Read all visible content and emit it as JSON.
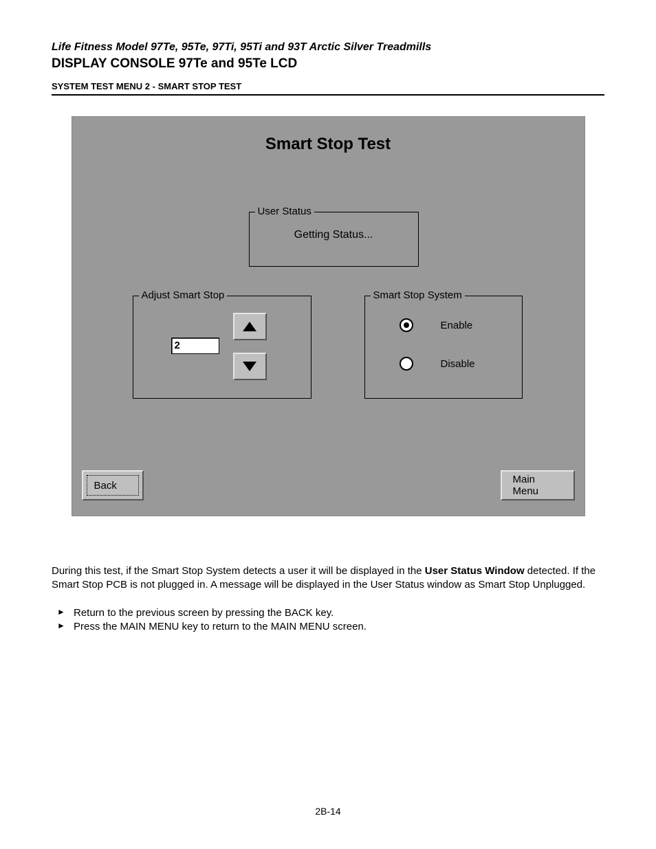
{
  "doc": {
    "supertitle": "Life Fitness Model 97Te, 95Te, 97Ti, 95Ti and 93T Arctic Silver Treadmills",
    "title": "DISPLAY CONSOLE 97Te and 95Te LCD",
    "section": "SYSTEM TEST MENU 2 - SMART STOP TEST",
    "page_number": "2B-14"
  },
  "screen": {
    "title": "Smart Stop Test",
    "user_status": {
      "legend": "User Status",
      "value": "Getting Status..."
    },
    "adjust": {
      "legend": "Adjust Smart Stop",
      "value": "2"
    },
    "system": {
      "legend": "Smart Stop System",
      "option_enable": "Enable",
      "option_disable": "Disable",
      "selected": "enable"
    },
    "buttons": {
      "back": "Back",
      "main_menu": "Main Menu"
    }
  },
  "body": {
    "paragraph_pre": "During this test, if the Smart Stop System detects a user it will be displayed in the ",
    "paragraph_bold": "User Status Window",
    "paragraph_post": " detected. If the Smart Stop PCB is not plugged in. A message will be displayed in the User Status window as Smart Stop Unplugged.",
    "bullets": [
      "Return to the previous screen by pressing the BACK key.",
      "Press the MAIN MENU key to return to the MAIN MENU screen."
    ]
  }
}
